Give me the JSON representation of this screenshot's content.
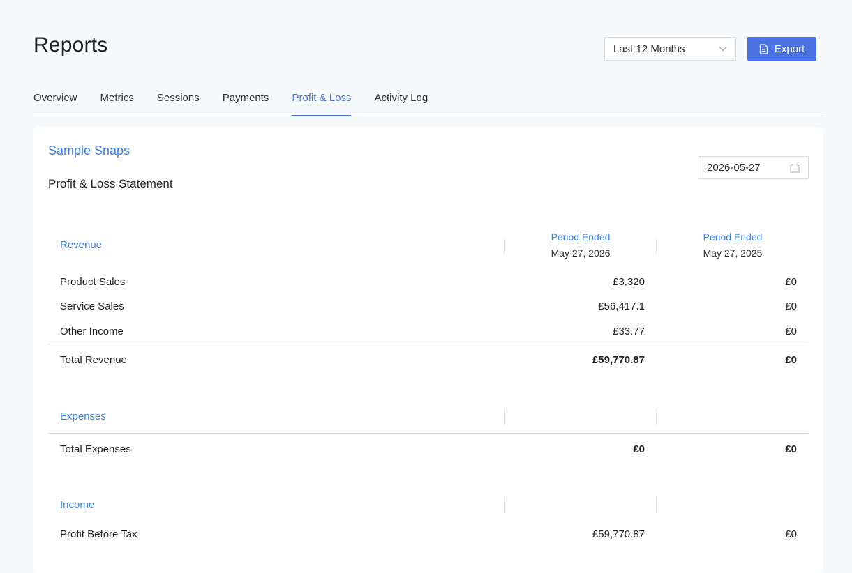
{
  "header": {
    "title": "Reports",
    "range_select": {
      "value": "Last 12 Months"
    },
    "export_label": "Export"
  },
  "tabs": [
    {
      "label": "Overview",
      "active": false
    },
    {
      "label": "Metrics",
      "active": false
    },
    {
      "label": "Sessions",
      "active": false
    },
    {
      "label": "Payments",
      "active": false
    },
    {
      "label": "Profit & Loss",
      "active": true
    },
    {
      "label": "Activity Log",
      "active": false
    }
  ],
  "report": {
    "company": "Sample Snaps",
    "statement_title": "Profit & Loss Statement",
    "date_value": "2026-05-27",
    "columns": [
      {
        "heading": "Period Ended",
        "date": "May 27, 2026"
      },
      {
        "heading": "Period Ended",
        "date": "May 27, 2025"
      }
    ],
    "revenue": {
      "label": "Revenue",
      "rows": [
        {
          "label": "Product Sales",
          "v1": "£3,320",
          "v2": "£0"
        },
        {
          "label": "Service Sales",
          "v1": "£56,417.1",
          "v2": "£0"
        },
        {
          "label": "Other Income",
          "v1": "£33.77",
          "v2": "£0"
        }
      ],
      "total": {
        "label": "Total Revenue",
        "v1": "£59,770.87",
        "v2": "£0"
      }
    },
    "expenses": {
      "label": "Expenses",
      "total": {
        "label": "Total Expenses",
        "v1": "£0",
        "v2": "£0"
      }
    },
    "income": {
      "label": "Income",
      "rows": [
        {
          "label": "Profit Before Tax",
          "v1": "£59,770.87",
          "v2": "£0"
        }
      ]
    }
  },
  "colors": {
    "accent": "#4a72e0",
    "link": "#3b82e8",
    "background": "#f7fafd"
  },
  "icons": {
    "export": "document-icon",
    "range": "chevron-down-icon",
    "date": "calendar-icon"
  }
}
